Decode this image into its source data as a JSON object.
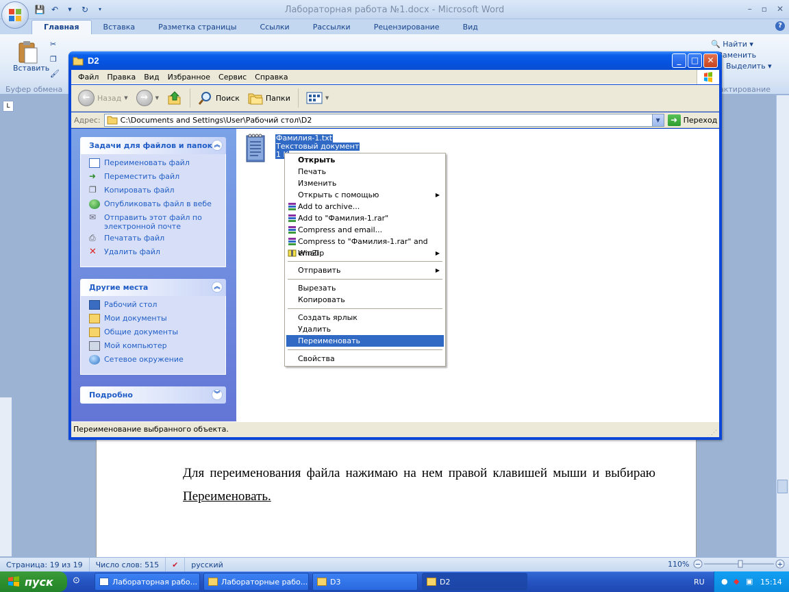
{
  "word": {
    "title": "Лабораторная работа №1.docx - Microsoft Word",
    "tabs": [
      "Главная",
      "Вставка",
      "Разметка страницы",
      "Ссылки",
      "Рассылки",
      "Рецензирование",
      "Вид"
    ],
    "ribbon": {
      "paste_label": "Вставить",
      "clipboard_group": "Буфер обмена",
      "find": "Найти",
      "replace": "Заменить",
      "select": "Выделить",
      "editing_group": "актирование"
    },
    "doc_text_part1": "Для переименования файла нажимаю на нем правой клавишей мыши и выбираю ",
    "doc_text_part2": "Переименовать.",
    "status": {
      "page": "Страница: 19 из 19",
      "words": "Число слов: 515",
      "lang": "русский",
      "zoom": "110%"
    }
  },
  "explorer": {
    "title": "D2",
    "menu": [
      "Файл",
      "Правка",
      "Вид",
      "Избранное",
      "Сервис",
      "Справка"
    ],
    "toolbar": {
      "back": "Назад",
      "search": "Поиск",
      "folders": "Папки"
    },
    "address": {
      "label": "Адрес:",
      "path": "C:\\Documents and Settings\\User\\Рабочий стол\\D2",
      "go": "Переход"
    },
    "tasks_panel": {
      "title": "Задачи для файлов и папок",
      "items": [
        "Переименовать файл",
        "Переместить файл",
        "Копировать файл",
        "Опубликовать файл в вебе",
        "Отправить этот файл по электронной почте",
        "Печатать файл",
        "Удалить файл"
      ]
    },
    "places_panel": {
      "title": "Другие места",
      "items": [
        "Рабочий стол",
        "Мои документы",
        "Общие документы",
        "Мой компьютер",
        "Сетевое окружение"
      ]
    },
    "details_panel": {
      "title": "Подробно"
    },
    "file": {
      "name": "Фамилия-1.txt",
      "type": "Текстовый документ",
      "size": "1 К"
    },
    "status": "Переименование выбранного объекта."
  },
  "context_menu": {
    "items": [
      {
        "label": "Открыть",
        "bold": true
      },
      {
        "label": "Печать"
      },
      {
        "label": "Изменить"
      },
      {
        "label": "Открыть с помощью",
        "submenu": true
      },
      {
        "label": "Add to archive...",
        "icon": "winrar-icon"
      },
      {
        "label": "Add to \"Фамилия-1.rar\"",
        "icon": "winrar-icon"
      },
      {
        "label": "Compress and email...",
        "icon": "winrar-icon"
      },
      {
        "label": "Compress to \"Фамилия-1.rar\" and email",
        "icon": "winrar-icon"
      },
      {
        "label": "WinZip",
        "icon": "winzip-icon",
        "submenu": true
      },
      {
        "label": "Отправить",
        "submenu": true
      },
      {
        "label": "Вырезать"
      },
      {
        "label": "Копировать"
      },
      {
        "label": "Создать ярлык"
      },
      {
        "label": "Удалить"
      },
      {
        "label": "Переименовать",
        "highlighted": true
      },
      {
        "label": "Свойства"
      }
    ]
  },
  "taskbar": {
    "start": "пуск",
    "buttons": [
      "Лабораторная рабо...",
      "Лабораторные рабо...",
      "D3",
      "D2"
    ],
    "lang": "RU",
    "clock": "15:14"
  },
  "colors": {
    "xp_blue": "#0a5fe9",
    "selection": "#316ac5",
    "task_link": "#215dc6",
    "start_green": "#2d8f2d"
  }
}
